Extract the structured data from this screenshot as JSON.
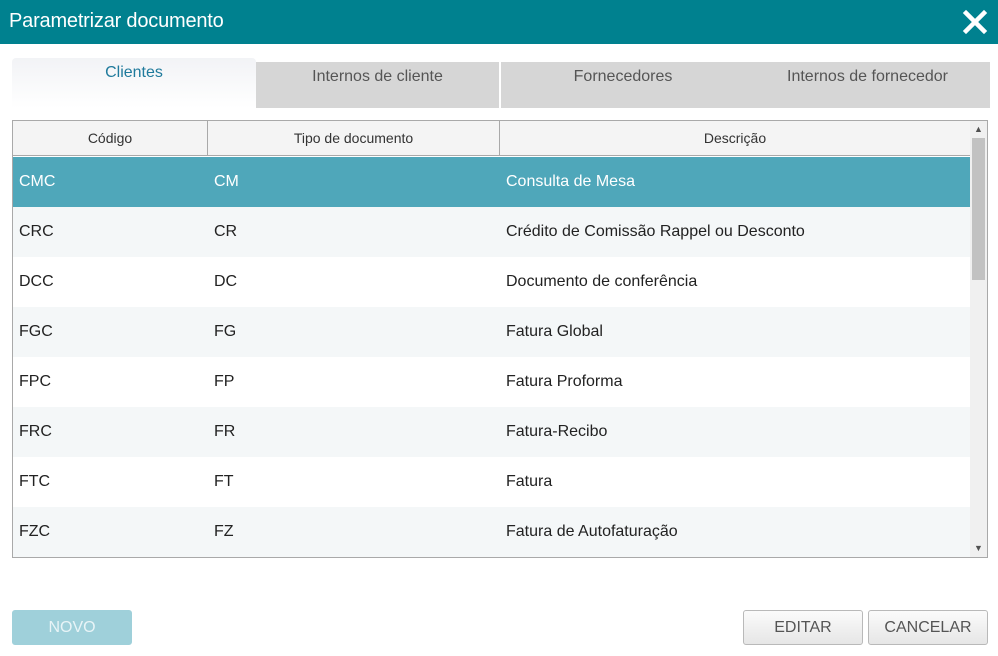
{
  "dialog": {
    "title": "Parametrizar documento"
  },
  "tabs": [
    {
      "label": "Clientes",
      "active": true
    },
    {
      "label": "Internos de cliente",
      "active": false
    },
    {
      "label": "Fornecedores",
      "active": false
    },
    {
      "label": "Internos de fornecedor",
      "active": false
    }
  ],
  "table": {
    "columns": [
      "Código",
      "Tipo de documento",
      "Descrição"
    ],
    "rows": [
      {
        "codigo": "CMC",
        "tipo": "CM",
        "descricao": "Consulta de Mesa",
        "selected": true
      },
      {
        "codigo": "CRC",
        "tipo": "CR",
        "descricao": "Crédito de Comissão  Rappel ou Desconto"
      },
      {
        "codigo": "DCC",
        "tipo": "DC",
        "descricao": "Documento de conferência"
      },
      {
        "codigo": "FGC",
        "tipo": "FG",
        "descricao": "Fatura Global"
      },
      {
        "codigo": "FPC",
        "tipo": "FP",
        "descricao": "Fatura Proforma"
      },
      {
        "codigo": "FRC",
        "tipo": "FR",
        "descricao": "Fatura-Recibo"
      },
      {
        "codigo": "FTC",
        "tipo": "FT",
        "descricao": "Fatura"
      },
      {
        "codigo": "FZC",
        "tipo": "FZ",
        "descricao": "Fatura de Autofaturação"
      }
    ]
  },
  "buttons": {
    "novo": "NOVO",
    "editar": "EDITAR",
    "cancelar": "CANCELAR"
  },
  "colors": {
    "titlebar": "#00818f",
    "selected_row": "#4fa7ba",
    "active_tab_text": "#1f7a9c",
    "novo_disabled": "#9fd0da"
  },
  "icons": {
    "close": "close-icon",
    "scroll_up": "chevron-up-icon",
    "scroll_down": "chevron-down-icon"
  }
}
